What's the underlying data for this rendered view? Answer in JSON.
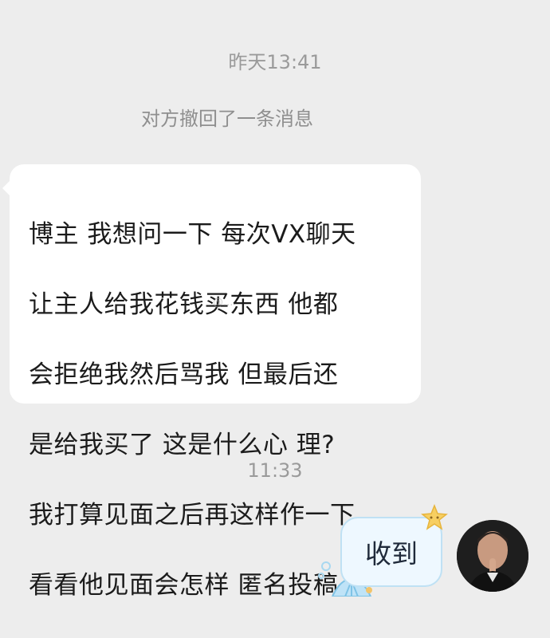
{
  "chat": {
    "timestamp_1": "昨天13:41",
    "recall_notice": "对方撤回了一条消息",
    "incoming_message": {
      "lines": [
        "博主 我想问一下 每次VX聊天",
        "让主人给我花钱买东西 他都",
        "会拒绝我然后骂我  但最后还",
        "是给我买了 这是什么心 理?",
        "我打算见面之后再这样作一下",
        "看看他见面会怎样 匿名投稿"
      ],
      "watermark": "@..."
    },
    "timestamp_2": "11:33",
    "outgoing_message": {
      "text": "收到"
    }
  },
  "icons": {
    "star": "star-icon",
    "shell": "shell-icon",
    "avatar": "avatar"
  },
  "colors": {
    "background": "#ededed",
    "incoming_bubble": "#ffffff",
    "outgoing_bubble": "#eef8ff",
    "outgoing_border": "#bfe1f4"
  }
}
